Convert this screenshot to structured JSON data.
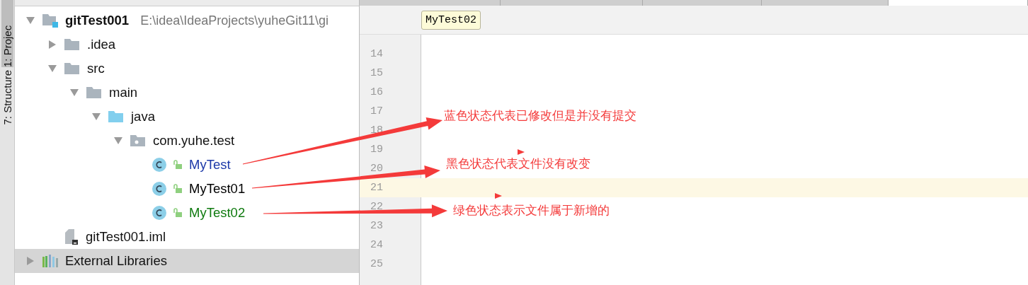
{
  "side_tabs": [
    {
      "label": "1: Projec",
      "selected": true
    },
    {
      "label": "7: Structure",
      "selected": false
    }
  ],
  "project_tree": [
    {
      "kind": "module",
      "label": "gitTest001",
      "path": "E:\\idea\\IdeaProjects\\yuheGit11\\gi",
      "expanded": true,
      "selected": false,
      "children": [
        {
          "kind": "folder",
          "label": ".idea",
          "expanded": false,
          "selected": false
        },
        {
          "kind": "folder",
          "label": "src",
          "expanded": true,
          "selected": false,
          "children": [
            {
              "kind": "folder",
              "label": "main",
              "expanded": true,
              "selected": false,
              "children": [
                {
                  "kind": "source-folder",
                  "label": "java",
                  "expanded": true,
                  "selected": false,
                  "children": [
                    {
                      "kind": "package",
                      "label": "com.yuhe.test",
                      "expanded": true,
                      "selected": false,
                      "children": [
                        {
                          "kind": "class",
                          "label": "MyTest",
                          "color": "#1c38a8",
                          "selected": false
                        },
                        {
                          "kind": "class",
                          "label": "MyTest01",
                          "color": "#000000",
                          "selected": false
                        },
                        {
                          "kind": "class",
                          "label": "MyTest02",
                          "color": "#0f7a0f",
                          "selected": false
                        }
                      ]
                    }
                  ]
                }
              ]
            }
          ]
        },
        {
          "kind": "file",
          "label": "gitTest001.iml",
          "selected": false
        }
      ]
    },
    {
      "kind": "library",
      "label": "External Libraries",
      "expanded": false,
      "selected": true
    }
  ],
  "editor_tabs": [
    {
      "selected": false
    },
    {
      "selected": false
    },
    {
      "selected": false
    },
    {
      "selected": false
    },
    {
      "selected": true
    }
  ],
  "tooltip": "MyTest02",
  "lines": [
    {
      "number": "14",
      "current": false
    },
    {
      "number": "15",
      "current": false
    },
    {
      "number": "16",
      "current": false
    },
    {
      "number": "17",
      "current": false
    },
    {
      "number": "18",
      "current": false
    },
    {
      "number": "19",
      "current": false
    },
    {
      "number": "20",
      "current": false
    },
    {
      "number": "21",
      "current": true
    },
    {
      "number": "22",
      "current": false
    },
    {
      "number": "23",
      "current": false
    },
    {
      "number": "24",
      "current": false
    },
    {
      "number": "25",
      "current": false
    }
  ],
  "annotations": [
    "蓝色状态代表已修改但是并没有提交",
    "黑色状态代表文件没有改变",
    "绿色状态表示文件属于新增的"
  ]
}
